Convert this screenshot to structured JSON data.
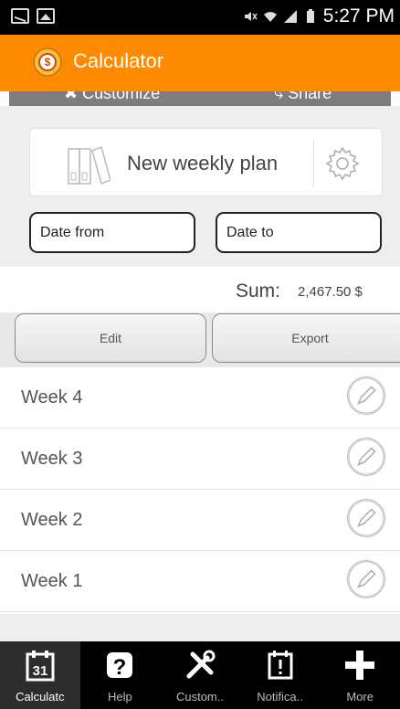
{
  "status_bar": {
    "time": "5:27 PM"
  },
  "app": {
    "title": "Calculator"
  },
  "toolbar": {
    "customize_label": "Customize",
    "share_label": "Share"
  },
  "plan": {
    "name": "New weekly plan"
  },
  "dates": {
    "from_placeholder": "Date from",
    "to_placeholder": "Date to"
  },
  "summary": {
    "label": "Sum:",
    "value": "2,467.50 $"
  },
  "actions": {
    "edit_label": "Edit",
    "export_label": "Export"
  },
  "weeks": [
    "Week 4",
    "Week 3",
    "Week 2",
    "Week 1"
  ],
  "bottom_nav": [
    {
      "label": "Calculatc",
      "icon": "calendar-31-icon",
      "active": true
    },
    {
      "label": "Help",
      "icon": "help-icon",
      "active": false
    },
    {
      "label": "Custom..",
      "icon": "tools-icon",
      "active": false
    },
    {
      "label": "Notifica..",
      "icon": "notification-icon",
      "active": false
    },
    {
      "label": "More",
      "icon": "plus-icon",
      "active": false
    }
  ],
  "colors": {
    "accent": "#ff8a00",
    "background": "#eeeeee"
  }
}
